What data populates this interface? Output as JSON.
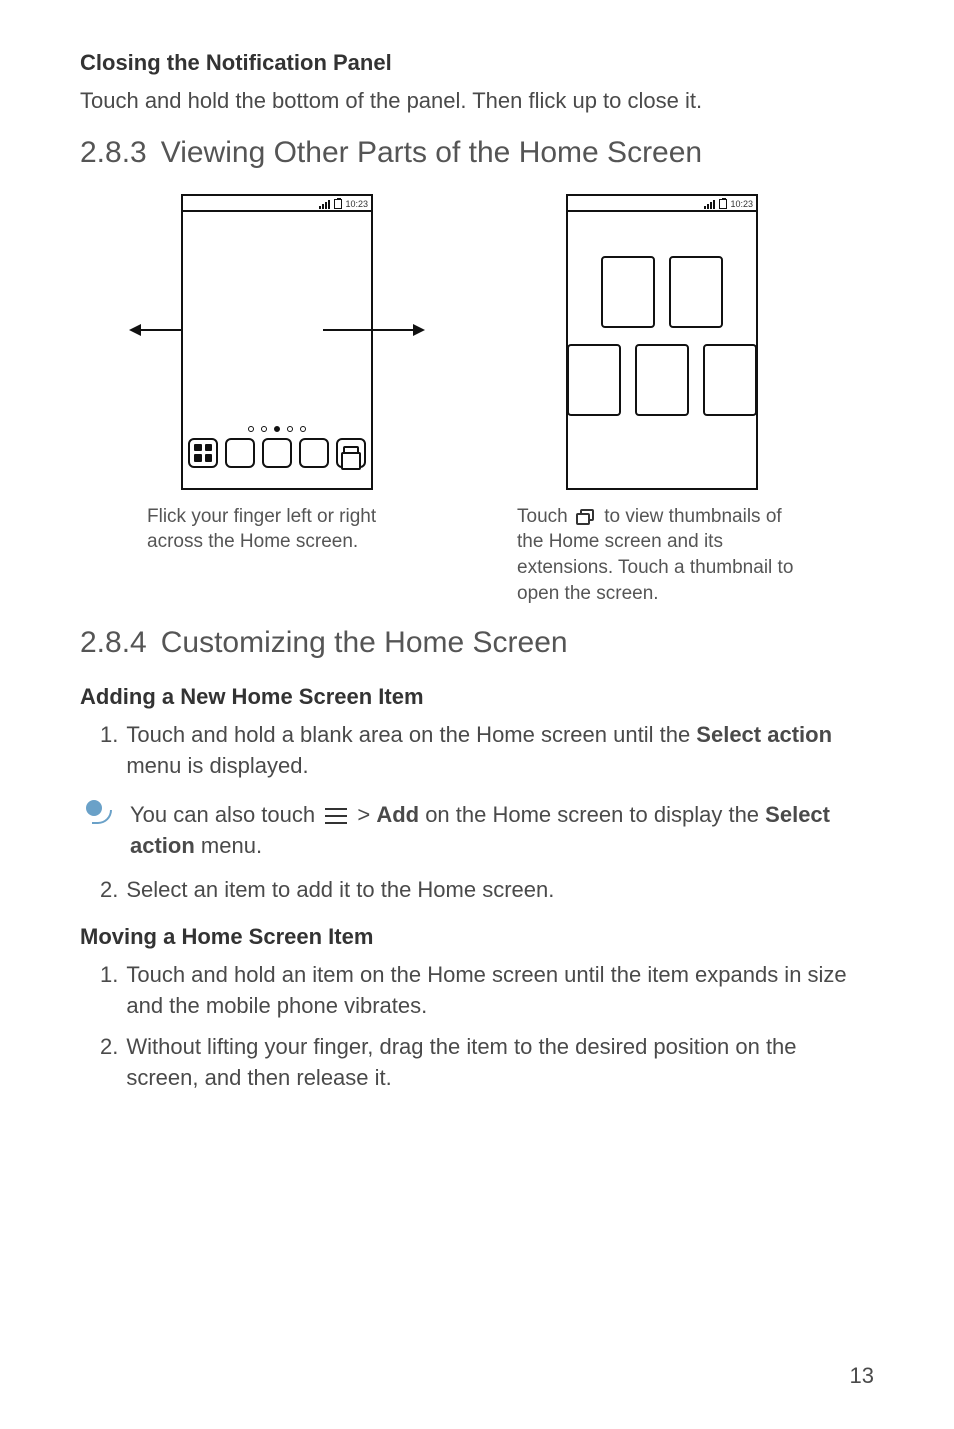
{
  "section_closing": {
    "title": "Closing the Notification Panel",
    "body": "Touch and hold the bottom of the panel. Then flick up to close it."
  },
  "section_viewing": {
    "num": "2.8.3",
    "title": "Viewing Other Parts of the Home Screen",
    "status_time": "10:23",
    "captionA": "Flick your finger left or right across the Home screen.",
    "captionB_pre": "Touch ",
    "captionB_post": " to view thumbnails of the Home screen and its extensions. Touch a thumbnail to open the screen."
  },
  "section_custom": {
    "num": "2.8.4",
    "title": "Customizing the Home Screen",
    "sub_adding": "Adding a New Home Screen Item",
    "add_steps": [
      {
        "num": "1.",
        "pre": "Touch and hold a blank area on the Home screen until the ",
        "bold": "Select action",
        "post": " menu is displayed."
      },
      {
        "num": "2.",
        "pre": "Select an item to add it to the Home screen.",
        "bold": "",
        "post": ""
      }
    ],
    "tip": {
      "pre": "You can also touch ",
      "mid1": " > ",
      "bold1": "Add",
      "mid2": " on the Home screen to display the ",
      "bold2": "Select action",
      "post": " menu."
    },
    "sub_moving": "Moving a Home Screen Item",
    "move_steps": [
      {
        "num": "1.",
        "text": "Touch and hold an item on the Home screen until the item expands in size and the mobile phone vibrates."
      },
      {
        "num": "2.",
        "text": "Without lifting your finger, drag the item to the desired position on the screen, and then release it."
      }
    ]
  },
  "page_number": "13"
}
